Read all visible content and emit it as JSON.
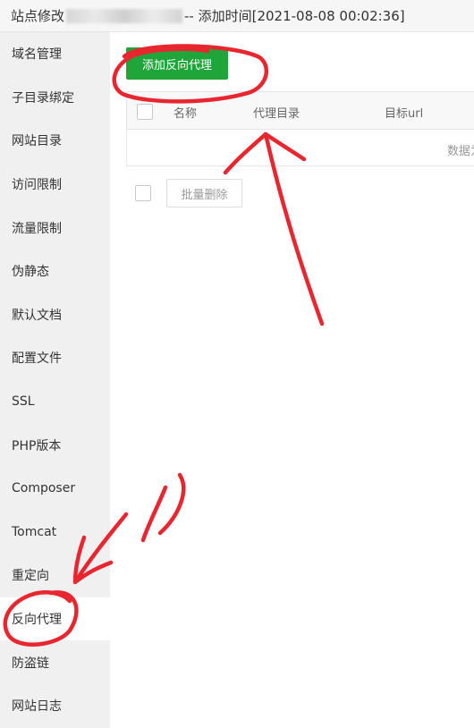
{
  "window": {
    "title_prefix": "站点修改",
    "title_suffix": " -- 添加时间[2021-08-08 00:02:36]"
  },
  "sidebar": {
    "items": [
      {
        "label": "域名管理"
      },
      {
        "label": "子目录绑定"
      },
      {
        "label": "网站目录"
      },
      {
        "label": "访问限制"
      },
      {
        "label": "流量限制"
      },
      {
        "label": "伪静态"
      },
      {
        "label": "默认文档"
      },
      {
        "label": "配置文件"
      },
      {
        "label": "SSL"
      },
      {
        "label": "PHP版本"
      },
      {
        "label": "Composer"
      },
      {
        "label": "Tomcat"
      },
      {
        "label": "重定向"
      },
      {
        "label": "反向代理"
      },
      {
        "label": "防盗链"
      },
      {
        "label": "网站日志"
      }
    ],
    "active": "反向代理"
  },
  "main": {
    "add_button": "添加反向代理",
    "table": {
      "columns": [
        "名称",
        "代理目录",
        "目标url"
      ],
      "empty_text": "数据为空"
    },
    "batch_delete": "批量删除"
  },
  "colors": {
    "accent": "#20a53a",
    "annotation": "#e8262f",
    "sidebar_bg": "#f0f0f0"
  }
}
